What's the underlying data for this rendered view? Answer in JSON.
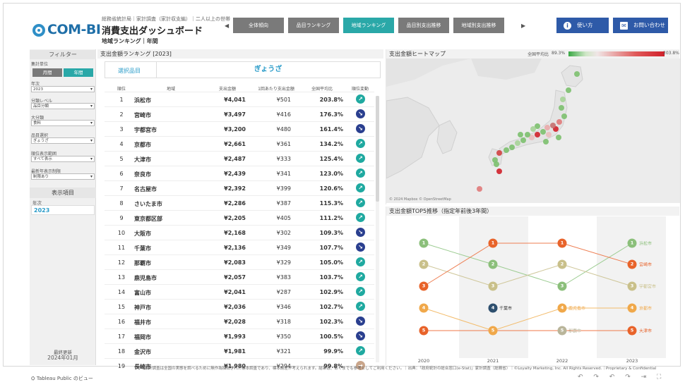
{
  "header": {
    "logo_text": "COM-BI",
    "subtitle_top": "総務省統計局｜家計調査（家計収支編）｜二人以上の世帯",
    "title": "消費支出ダッシュボード",
    "subtitle_bottom": "地域ランキング｜年間",
    "nav_prev": "◀",
    "nav_next": "▶",
    "nav_tabs": [
      "全体傾向",
      "品目ランキング",
      "地域ランキング",
      "品目別支出推移",
      "地域別支出推移"
    ],
    "active_tab": 2,
    "howto_label": "使い方",
    "contact_label": "お問い合わせ",
    "howto_icon": "info-icon",
    "contact_icon": "mail-icon",
    "accent_color": "#2aa8a8",
    "button_color": "#2e5aa8"
  },
  "filters": {
    "title": "フィルター",
    "period_label": "集計単位",
    "period_options": [
      "月間",
      "年間"
    ],
    "year_label": "年次",
    "year_value": "2023",
    "class_level_label": "分類レベル",
    "class_level_value": "品目分類",
    "major_label": "大分類",
    "major_value": "食料",
    "item_label": "品目選択",
    "item_value": "ぎょうざ",
    "rank_range_label": "順位表示範囲",
    "rank_range_value": "すべて表示",
    "latest_label": "最新年表示制限",
    "latest_value": "制限あり",
    "display_title": "表示項目",
    "display_year_label": "年次",
    "display_year_value": "2023",
    "updated_label": "最終更新",
    "updated_value": "2024年01月"
  },
  "ranking": {
    "panel_title": "支出金額ランキング [2023]",
    "selected_item_label": "選択品目",
    "selected_item_value": "ぎょうざ",
    "columns": [
      "順位",
      "地域",
      "支出金額",
      "1回あたり支出金額",
      "全国平均比",
      "順位変動"
    ],
    "rows": [
      {
        "rank": "1",
        "region": "浜松市",
        "amount": "¥4,041",
        "per": "¥501",
        "ratio": "203.8%",
        "change": "up"
      },
      {
        "rank": "2",
        "region": "宮崎市",
        "amount": "¥3,497",
        "per": "¥416",
        "ratio": "176.3%",
        "change": "down"
      },
      {
        "rank": "3",
        "region": "宇都宮市",
        "amount": "¥3,200",
        "per": "¥480",
        "ratio": "161.4%",
        "change": "down"
      },
      {
        "rank": "4",
        "region": "京都市",
        "amount": "¥2,661",
        "per": "¥361",
        "ratio": "134.2%",
        "change": "up"
      },
      {
        "rank": "5",
        "region": "大津市",
        "amount": "¥2,487",
        "per": "¥333",
        "ratio": "125.4%",
        "change": "up"
      },
      {
        "rank": "6",
        "region": "奈良市",
        "amount": "¥2,439",
        "per": "¥341",
        "ratio": "123.0%",
        "change": "up"
      },
      {
        "rank": "7",
        "region": "名古屋市",
        "amount": "¥2,392",
        "per": "¥399",
        "ratio": "120.6%",
        "change": "up"
      },
      {
        "rank": "8",
        "region": "さいたま市",
        "amount": "¥2,286",
        "per": "¥387",
        "ratio": "115.3%",
        "change": "up"
      },
      {
        "rank": "9",
        "region": "東京都区部",
        "amount": "¥2,205",
        "per": "¥405",
        "ratio": "111.2%",
        "change": "up"
      },
      {
        "rank": "10",
        "region": "大阪市",
        "amount": "¥2,168",
        "per": "¥302",
        "ratio": "109.3%",
        "change": "down"
      },
      {
        "rank": "11",
        "region": "千葉市",
        "amount": "¥2,136",
        "per": "¥349",
        "ratio": "107.7%",
        "change": "down"
      },
      {
        "rank": "12",
        "region": "那覇市",
        "amount": "¥2,083",
        "per": "¥329",
        "ratio": "105.0%",
        "change": "up"
      },
      {
        "rank": "13",
        "region": "鹿児島市",
        "amount": "¥2,057",
        "per": "¥383",
        "ratio": "103.7%",
        "change": "up"
      },
      {
        "rank": "14",
        "region": "富山市",
        "amount": "¥2,041",
        "per": "¥287",
        "ratio": "102.9%",
        "change": "up"
      },
      {
        "rank": "15",
        "region": "神戸市",
        "amount": "¥2,036",
        "per": "¥346",
        "ratio": "102.7%",
        "change": "up"
      },
      {
        "rank": "16",
        "region": "福井市",
        "amount": "¥2,028",
        "per": "¥318",
        "ratio": "102.3%",
        "change": "down"
      },
      {
        "rank": "17",
        "region": "福岡市",
        "amount": "¥1,993",
        "per": "¥350",
        "ratio": "100.5%",
        "change": "down"
      },
      {
        "rank": "18",
        "region": "金沢市",
        "amount": "¥1,981",
        "per": "¥321",
        "ratio": "99.9%",
        "change": "up"
      },
      {
        "rank": "19",
        "region": "長崎市",
        "amount": "¥1,980",
        "per": "¥294",
        "ratio": "99.8%",
        "change": "same"
      }
    ],
    "up_color": "#1fa9a0",
    "down_color": "#2a3f8f",
    "same_color": "#c9a58a"
  },
  "heatmap": {
    "panel_title": "支出金額ヒートマップ",
    "legend_label": "全国平均比",
    "legend_min": "89.3%",
    "legend_max": "203.8%",
    "credit": "© 2024 Mapbox © OpenStreetMap"
  },
  "top5": {
    "panel_title": "支出金額TOP5推移（指定年前後3年間）",
    "years": [
      "2020",
      "2021",
      "2022",
      "2023"
    ],
    "rank_colors": [
      "#8bbf7a",
      "#c9c08a",
      "#e8632a",
      "#f0a84a",
      "#e8632a"
    ],
    "labels_2021": [
      "千葉市"
    ],
    "labels_2022": [
      "鹿児島市",
      "那覇市"
    ],
    "labels_2023": [
      "浜松市",
      "宮崎市",
      "宇都宮市",
      "京都市",
      "大津市"
    ]
  },
  "footer": {
    "note": "※家計調査は全国の実態を調べるために無作為抽出された標本調査であり、標本誤差が考えられます。結果は、あくまでも参考としてご利用ください。｜出典：「政府統計の総合窓口(e-Stat)」家計調査（総務省）｜©Loyalty Marketing, Inc. All Rights Reserved.｜Proprietary & Confidential",
    "tableau_label": "Tableau Public のビュー",
    "controls": "↶ ↷ ↶ ↷ ⇥ ⛶"
  }
}
